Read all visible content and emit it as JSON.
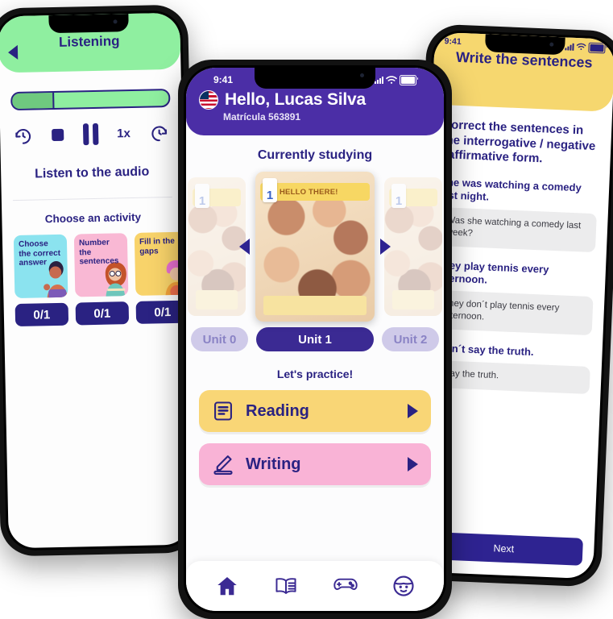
{
  "left_phone": {
    "header_title": "Listening",
    "back_icon": "back-arrow-icon",
    "player": {
      "rewind_icon": "rewind-15-icon",
      "stop_icon": "stop-icon",
      "pause_icon": "pause-icon",
      "speed_label": "1x",
      "forward_icon": "forward-15-icon",
      "progress_percent": 26
    },
    "listen_label": "Listen to the audio",
    "choose_label": "Choose an activity",
    "activities": [
      {
        "label": "Choose the correct answer",
        "score": "0/1",
        "color": "#8BE3EF"
      },
      {
        "label": "Number the sentences",
        "score": "0/1",
        "color": "#F9B8D4"
      },
      {
        "label": "Fill in the gaps",
        "score": "0/1",
        "color": "#F8D36A"
      }
    ]
  },
  "center_phone": {
    "status": {
      "time": "9:41",
      "signal_icon": "cellular-bars-icon",
      "wifi_icon": "wifi-icon",
      "battery_icon": "battery-icon"
    },
    "header": {
      "flag_icon": "us-flag-icon",
      "greeting": "Hello, Lucas Silva",
      "enrollment": "Matrícula 563891"
    },
    "currently_studying_label": "Currently studying",
    "carousel": {
      "prev_icon": "carousel-prev-arrow-icon",
      "next_icon": "carousel-next-arrow-icon",
      "cover_banner": "HELLO THERE!",
      "cover_unit_number": "1"
    },
    "unit_tabs": [
      {
        "label": "Unit 0",
        "active": false
      },
      {
        "label": "Unit 1",
        "active": true
      },
      {
        "label": "Unit 2",
        "active": false
      }
    ],
    "practice_label": "Let's practice!",
    "practice_buttons": [
      {
        "label": "Reading",
        "icon": "document-lines-icon",
        "color": "#F9D676"
      },
      {
        "label": "Writing",
        "icon": "pencil-icon",
        "color": "#F9B3D6"
      }
    ],
    "tabbar": [
      {
        "icon": "home-icon",
        "name": "tab-home"
      },
      {
        "icon": "book-icon",
        "name": "tab-library"
      },
      {
        "icon": "gamepad-icon",
        "name": "tab-games"
      },
      {
        "icon": "avatar-face-icon",
        "name": "tab-profile"
      }
    ]
  },
  "right_phone": {
    "status": {
      "time": "9:41",
      "signal_icon": "cellular-bars-icon",
      "wifi_icon": "wifi-icon",
      "battery_icon": "battery-icon"
    },
    "header_title": "Write the sentences",
    "instruction": "Correct the sentences in the interrogative / negative / affirmative form.",
    "items": [
      {
        "prompt": "She was watching a comedy last night.",
        "answer": "Was she watching a comedy last week?"
      },
      {
        "prompt": "They play tennis every afternoon.",
        "answer": "They don´t play tennis every afternoon."
      },
      {
        "prompt": "I don´t say the truth.",
        "answer": "I say the truth."
      }
    ],
    "next_label": "Next"
  },
  "colors": {
    "purple": "#4B2EA6",
    "deep_purple": "#2A2282",
    "green": "#8FEFA0",
    "yellow": "#F6D76F",
    "pink": "#F9B3D6",
    "cyan": "#8BE3EF"
  }
}
